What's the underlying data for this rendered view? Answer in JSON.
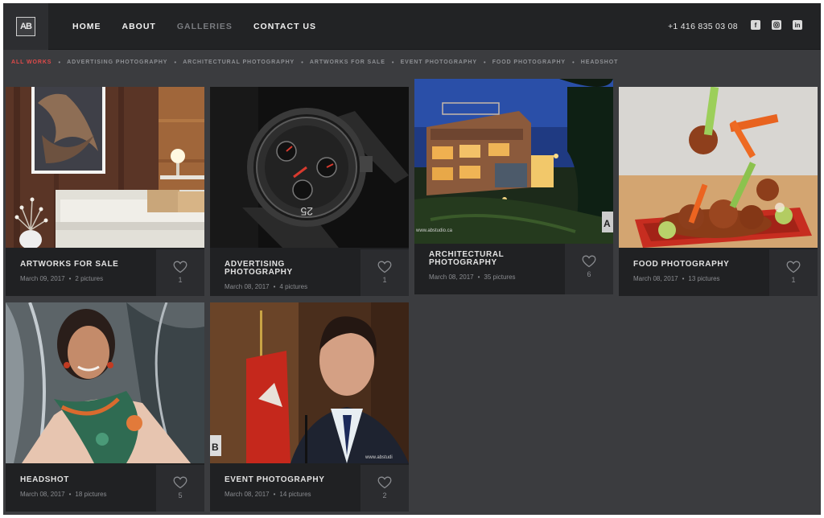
{
  "header": {
    "logo_text": "AB",
    "nav": [
      "HOME",
      "ABOUT",
      "GALLERIES",
      "CONTACT US"
    ],
    "active_nav": "GALLERIES",
    "phone": "+1 416 835 03 08",
    "social_icons": [
      "facebook-icon",
      "instagram-icon",
      "linkedin-icon"
    ]
  },
  "filters": [
    "ALL WORKS",
    "ADVERTISING PHOTOGRAPHY",
    "ARCHITECTURAL PHOTOGRAPHY",
    "ARTWORKS FOR SALE",
    "EVENT PHOTOGRAPHY",
    "FOOD PHOTOGRAPHY",
    "HEADSHOT"
  ],
  "active_filter": "ALL WORKS",
  "cards": [
    {
      "title": "ARTWORKS FOR SALE",
      "date": "March 09, 2017",
      "count": "2 pictures",
      "likes": "1"
    },
    {
      "title": "ADVERTISING PHOTOGRAPHY",
      "date": "March 08, 2017",
      "count": "4 pictures",
      "likes": "1"
    },
    {
      "title": "ARCHITECTURAL PHOTOGRAPHY",
      "date": "March 08, 2017",
      "count": "35 pictures",
      "likes": "6"
    },
    {
      "title": "FOOD PHOTOGRAPHY",
      "date": "March 08, 2017",
      "count": "13 pictures",
      "likes": "1"
    },
    {
      "title": "HEADSHOT",
      "date": "March 08, 2017",
      "count": "18 pictures",
      "likes": "5"
    },
    {
      "title": "EVENT PHOTOGRAPHY",
      "date": "March 08, 2017",
      "count": "14 pictures",
      "likes": "2"
    }
  ],
  "watermarks": {
    "architectural": "www.abstudio.ca",
    "event": "www.abstudi"
  },
  "colors": {
    "accent": "#e04a4a",
    "background": "#3b3c3f",
    "header": "#222325"
  }
}
